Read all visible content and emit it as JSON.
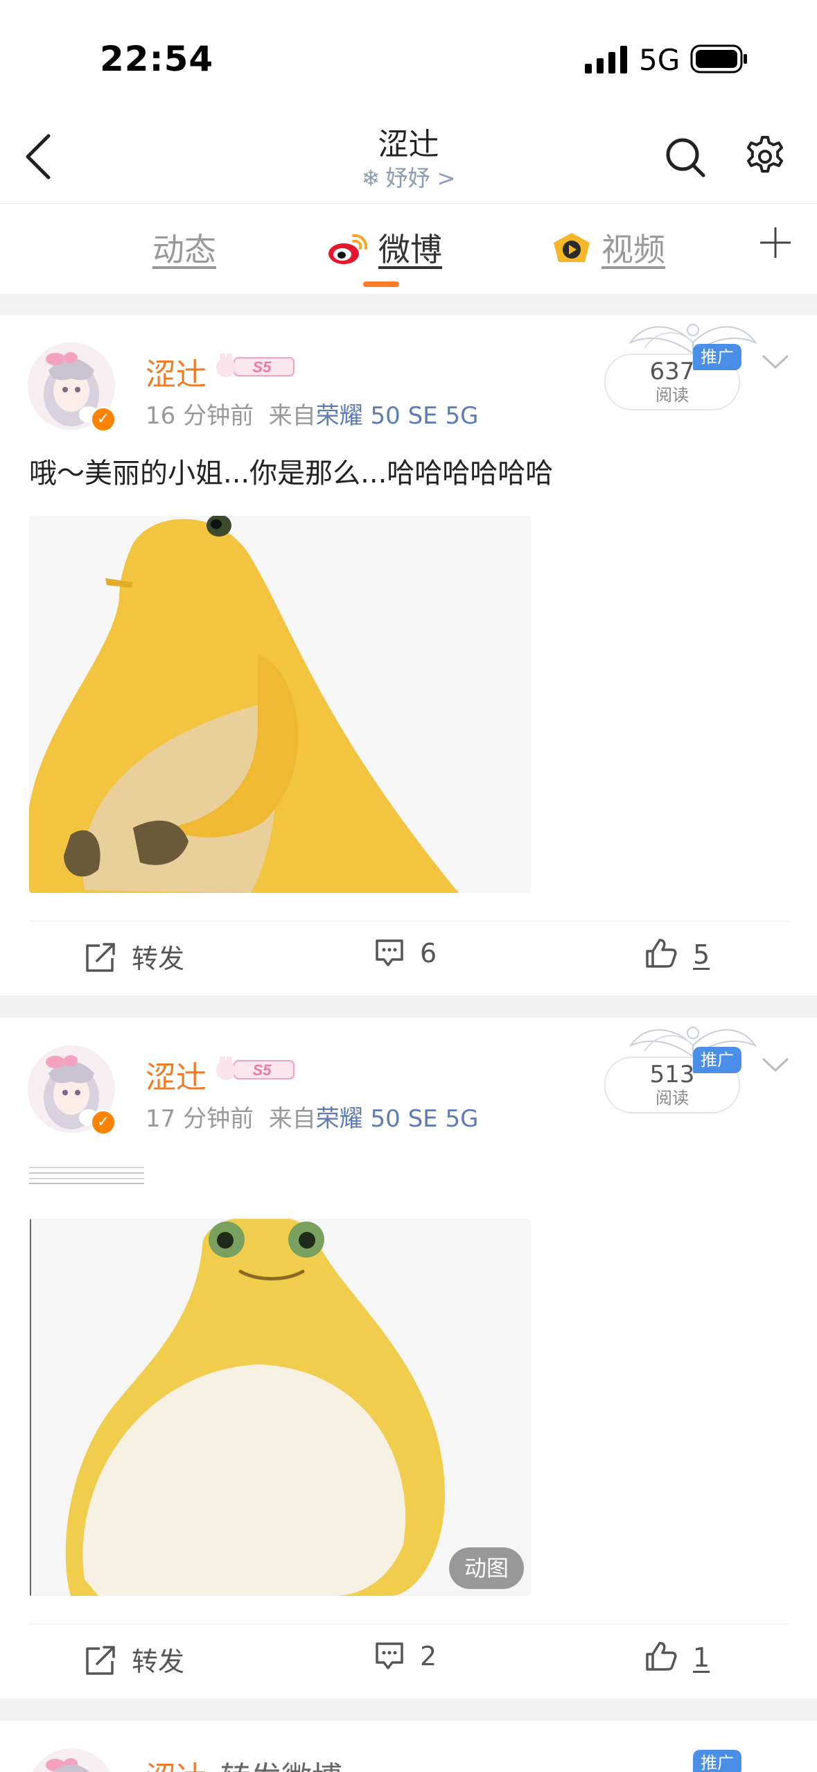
{
  "status_bar": {
    "time": "22:54",
    "network": "5G"
  },
  "header": {
    "title": "涩辻",
    "subtitle": "妤妤 >",
    "icons": [
      "back-arrow-icon",
      "search-icon",
      "gear-icon"
    ]
  },
  "tabs": [
    {
      "label": "动态",
      "active": false
    },
    {
      "label": "微博",
      "active": true
    },
    {
      "label": "视频",
      "active": false
    }
  ],
  "colors": {
    "accent": "#ff7a2a",
    "username": "#f07a26",
    "device_link": "#5d7bb5",
    "promo": "#4a8ee8"
  },
  "posts": [
    {
      "username": "涩辻",
      "vip_label": "S5",
      "time": "16 分钟前",
      "source_prefix": "来自",
      "device": "荣耀 50 SE 5G",
      "reads": "637",
      "reads_label": "阅读",
      "promo_label": "推广",
      "text": "哦～美丽的小姐...你是那么...哈哈哈哈哈哈",
      "repost_label": "转发",
      "comments": "6",
      "likes": "5"
    },
    {
      "username": "涩辻",
      "vip_label": "S5",
      "time": "17 分钟前",
      "source_prefix": "来自",
      "device": "荣耀 50 SE 5G",
      "reads": "513",
      "reads_label": "阅读",
      "promo_label": "推广",
      "gif_badge": "动图",
      "repost_label": "转发",
      "comments": "2",
      "likes": "1"
    },
    {
      "username": "涩辻",
      "suffix": "转发微博",
      "promo_label": "推广"
    }
  ]
}
